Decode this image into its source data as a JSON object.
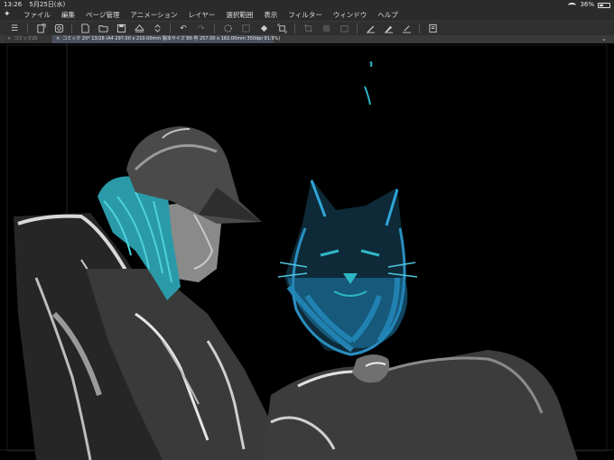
{
  "status": {
    "time": "13:26",
    "date": "5月25日(水)",
    "battery": "36%"
  },
  "menu": {
    "logo_icon": "clip-studio-logo-icon",
    "items": [
      "ファイル",
      "編集",
      "ページ管理",
      "アニメーション",
      "レイヤー",
      "選択範囲",
      "表示",
      "フィルター",
      "ウィンドウ",
      "ヘルプ"
    ]
  },
  "toolbar": {
    "icons": [
      "menu-icon",
      "new-file-icon",
      "settings-icon",
      "new-page-icon",
      "open-folder-icon",
      "save-icon",
      "export-icon",
      "stepper-icon",
      "undo-icon",
      "redo-icon",
      "lasso-icon",
      "clear-icon",
      "fill-icon",
      "transform-icon",
      "crop-icon",
      "layer-fill-icon",
      "layer-icon",
      "pen-icon",
      "brush-icon",
      "pencil-icon",
      "page-icon"
    ]
  },
  "tabs": {
    "tab1": "コミック20",
    "tab2": "コミック 20* 13/28 (A4 297.00 x 210.00mm 製本サイズ B6 判 257.00 x 182.00mm 350dpi 91.9%)"
  },
  "colors": {
    "accent_teal": "#2fb7c8",
    "cat_blue": "#2a8fc0",
    "background": "#000000"
  }
}
